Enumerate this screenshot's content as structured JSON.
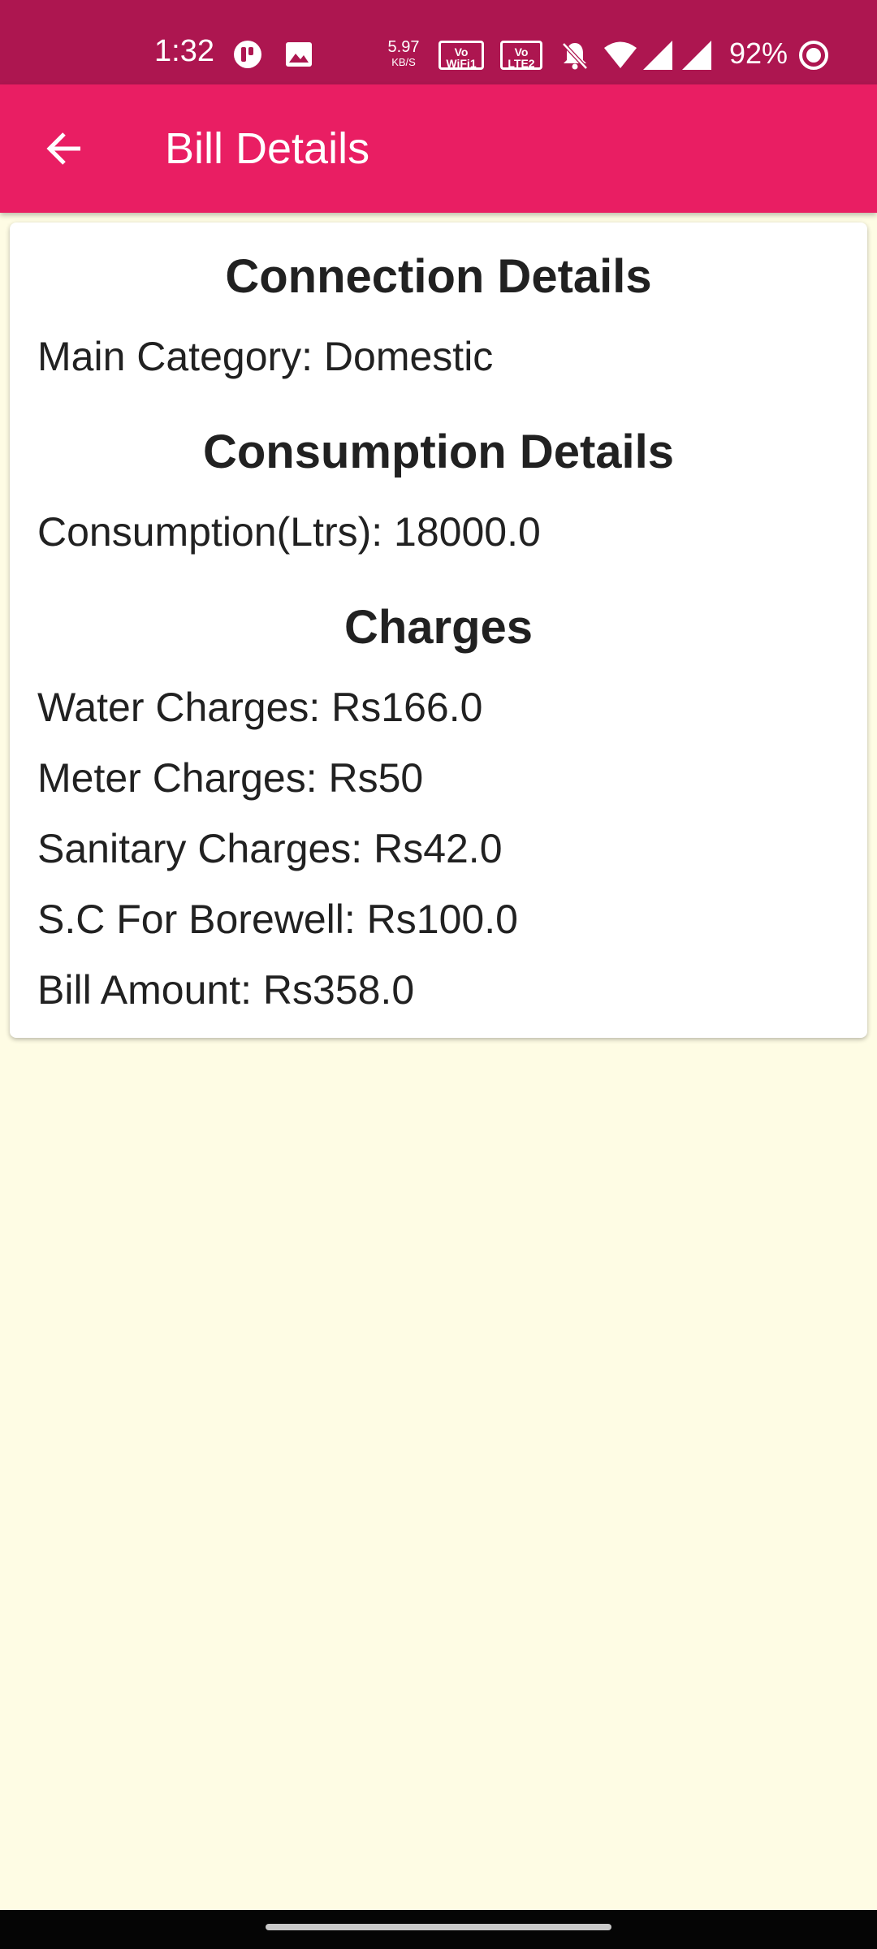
{
  "status_bar": {
    "time": "1:32",
    "net_speed_value": "5.97",
    "net_speed_unit": "KB/S",
    "sim1_tag": "Vo WiFi1",
    "sim2_tag": "Vo LTE2",
    "battery": "92%",
    "background_color": "#ad1650"
  },
  "app_bar": {
    "title": "Bill Details",
    "back_icon": "arrow-back-icon",
    "background_color": "#e91e63"
  },
  "connection": {
    "heading": "Connection Details",
    "main_category": "Main Category: Domestic"
  },
  "consumption": {
    "heading": "Consumption Details",
    "consumption_ltrs": "Consumption(Ltrs): 18000.0"
  },
  "charges": {
    "heading": "Charges",
    "items": [
      "Water Charges: Rs166.0",
      "Meter Charges: Rs50",
      "Sanitary Charges: Rs42.0",
      "S.C For Borewell: Rs100.0",
      "Bill Amount: Rs358.0"
    ]
  },
  "page_background": "#fefce4"
}
